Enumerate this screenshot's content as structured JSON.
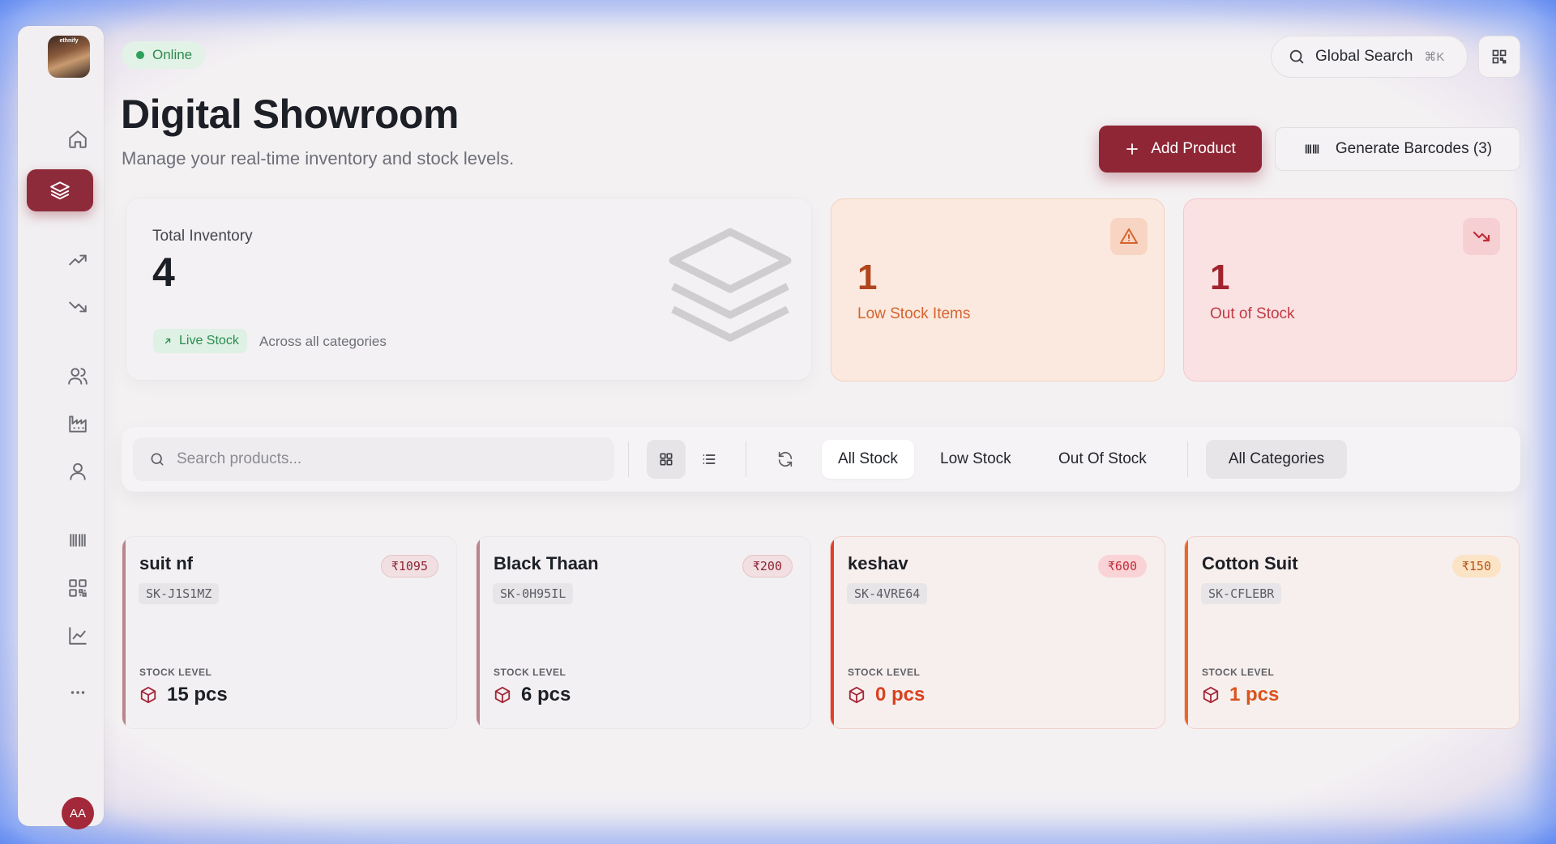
{
  "sidebar": {
    "logo_text": "ethnify",
    "items": [
      {
        "name": "home-icon"
      },
      {
        "name": "layers-icon",
        "active": true
      },
      {
        "name": "trending-up-icon"
      },
      {
        "name": "trending-down-icon"
      },
      {
        "name": "users-icon"
      },
      {
        "name": "factory-icon"
      },
      {
        "name": "user-icon"
      },
      {
        "name": "barcode-icon"
      },
      {
        "name": "qr-code-icon"
      },
      {
        "name": "line-chart-icon"
      },
      {
        "name": "more-icon"
      }
    ],
    "avatar": "AA"
  },
  "header": {
    "status": "Online",
    "title": "Digital Showroom",
    "subtitle": "Manage your real-time inventory and stock levels.",
    "global_search": "Global Search",
    "shortcut": "⌘K",
    "add_product": "Add Product",
    "generate_barcodes": "Generate Barcodes (3)"
  },
  "stats": {
    "total": {
      "label": "Total Inventory",
      "value": "4",
      "badge": "Live Stock",
      "note": "Across all categories"
    },
    "low": {
      "value": "1",
      "label": "Low Stock Items"
    },
    "out": {
      "value": "1",
      "label": "Out of Stock"
    }
  },
  "toolbar": {
    "search_placeholder": "Search products...",
    "filters": [
      "All Stock",
      "Low Stock",
      "Out Of Stock"
    ],
    "active_filter": "All Stock",
    "category": "All Categories"
  },
  "products": [
    {
      "name": "suit nf",
      "price": "₹1095",
      "sku": "SK-J1S1MZ",
      "stock_label": "STOCK LEVEL",
      "stock": "15 pcs"
    },
    {
      "name": "Black Thaan",
      "price": "₹200",
      "sku": "SK-0H95IL",
      "stock_label": "STOCK LEVEL",
      "stock": "6 pcs"
    },
    {
      "name": "keshav",
      "price": "₹600",
      "sku": "SK-4VRE64",
      "stock_label": "STOCK LEVEL",
      "stock": "0 pcs"
    },
    {
      "name": "Cotton Suit",
      "price": "₹150",
      "sku": "SK-CFLEBR",
      "stock_label": "STOCK LEVEL",
      "stock": "1 pcs"
    }
  ],
  "colors": {
    "primary": "#8f2635",
    "online": "#2ea05a",
    "low_stock": "#d4642e",
    "out_of_stock": "#c23a43"
  }
}
